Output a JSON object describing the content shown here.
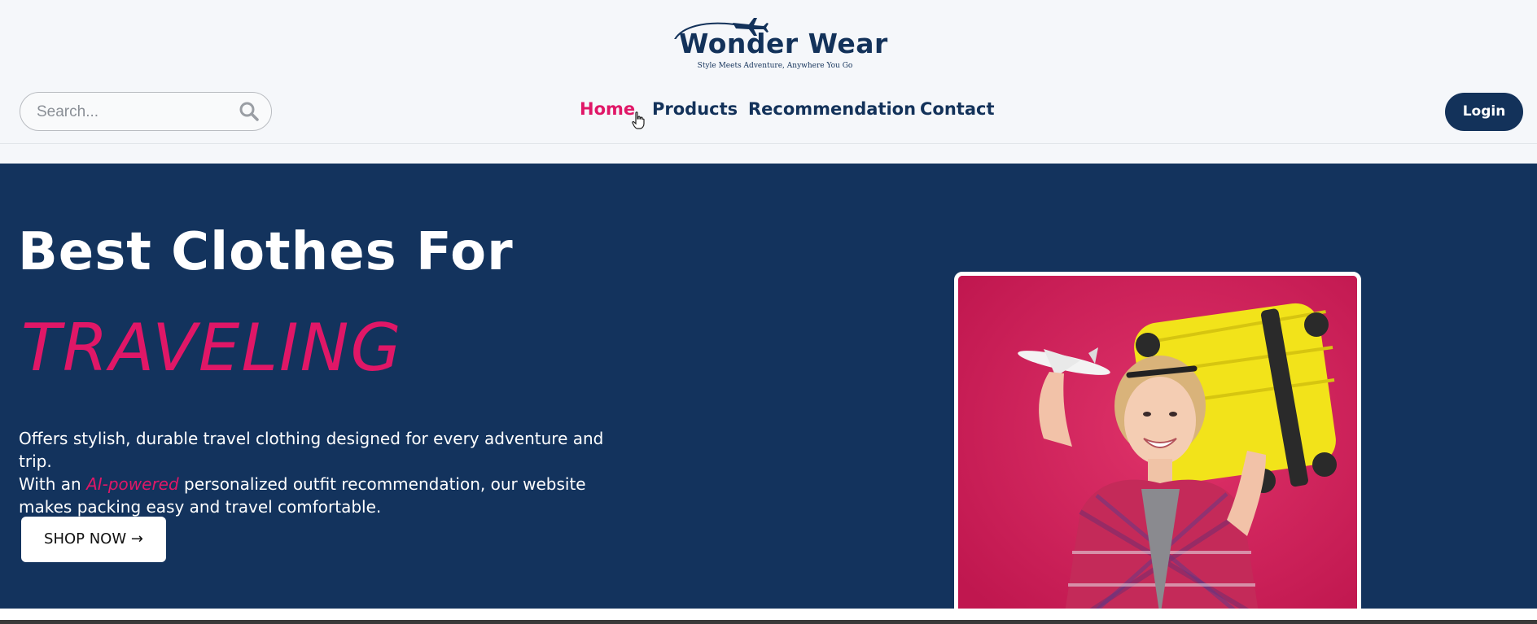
{
  "brand": {
    "name": "Wonder Wear",
    "tagline": "Style Meets Adventure, Anywhere You Go"
  },
  "search": {
    "placeholder": "Search...",
    "value": ""
  },
  "nav": {
    "items": [
      {
        "label": "Home",
        "active": true
      },
      {
        "label": "Products",
        "active": false
      },
      {
        "label": "Recommendation",
        "active": false
      },
      {
        "label": "Contact",
        "active": false
      }
    ]
  },
  "header": {
    "login_label": "Login"
  },
  "hero": {
    "title": "Best Clothes For",
    "highlight": "TRAVELING",
    "desc_line1": "Offers stylish, durable travel clothing designed for every adventure and trip.",
    "desc_line2_before": "With an ",
    "desc_ai": "AI-powered",
    "desc_line2_after": " personalized outfit recommendation, our website",
    "desc_line3": "makes packing easy and travel comfortable.",
    "cta_label": "SHOP NOW →"
  },
  "colors": {
    "navy": "#13325a",
    "hero_bg": "#13335d",
    "accent": "#e01767",
    "suitcase": "#f2e31a"
  },
  "icons": {
    "search": "search-icon",
    "cursor": "hand-cursor-icon",
    "plane": "airplane-icon"
  }
}
